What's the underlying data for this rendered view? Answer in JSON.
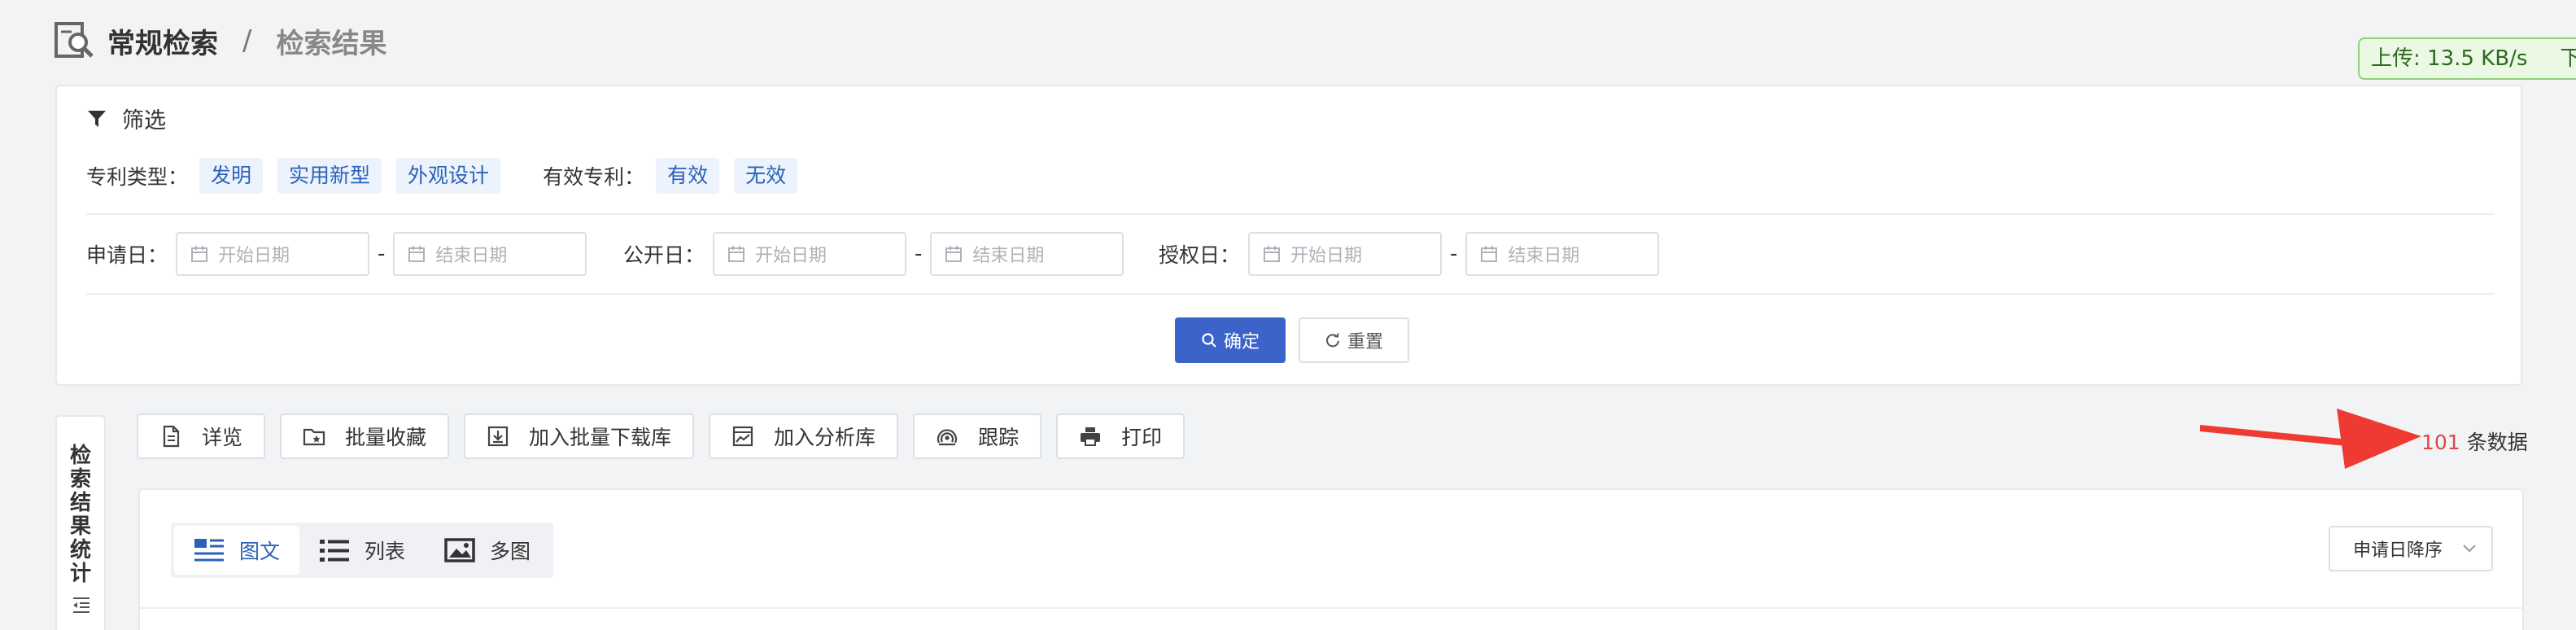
{
  "header": {
    "logo_icon": "search-document-icon",
    "breadcrumb_main": "常规检索",
    "breadcrumb_sep": "/",
    "breadcrumb_sub": "检索结果"
  },
  "speed": {
    "upload": "上传: 13.5 KB/s",
    "download": "下载"
  },
  "filter": {
    "title": "筛选",
    "patent_type_label": "专利类型：",
    "patent_types": [
      "发明",
      "实用新型",
      "外观设计"
    ],
    "valid_label": "有效专利：",
    "valid_options": [
      "有效",
      "无效"
    ],
    "apply_date_label": "申请日：",
    "publish_date_label": "公开日：",
    "grant_date_label": "授权日：",
    "start_placeholder": "开始日期",
    "end_placeholder": "结束日期",
    "dash": "-",
    "confirm": "确定",
    "reset": "重置"
  },
  "stats_tab": {
    "label": "检索结果统计"
  },
  "toolbar": {
    "items": [
      {
        "label": "详览",
        "icon": "document-icon"
      },
      {
        "label": "批量收藏",
        "icon": "folder-star-icon"
      },
      {
        "label": "加入批量下载库",
        "icon": "download-icon"
      },
      {
        "label": "加入分析库",
        "icon": "chart-icon"
      },
      {
        "label": "跟踪",
        "icon": "radar-icon"
      },
      {
        "label": "打印",
        "icon": "printer-icon"
      }
    ]
  },
  "results": {
    "count": "101",
    "count_unit": "条数据",
    "views": [
      {
        "label": "图文",
        "icon": "image-text-icon",
        "active": true
      },
      {
        "label": "列表",
        "icon": "list-icon",
        "active": false
      },
      {
        "label": "多图",
        "icon": "multi-image-icon",
        "active": false
      }
    ],
    "sort": "申请日降序"
  },
  "colors": {
    "primary": "#3b63c9",
    "tag_text": "#2b62b8",
    "count": "#e0474b",
    "arrow": "#ee3a32"
  }
}
